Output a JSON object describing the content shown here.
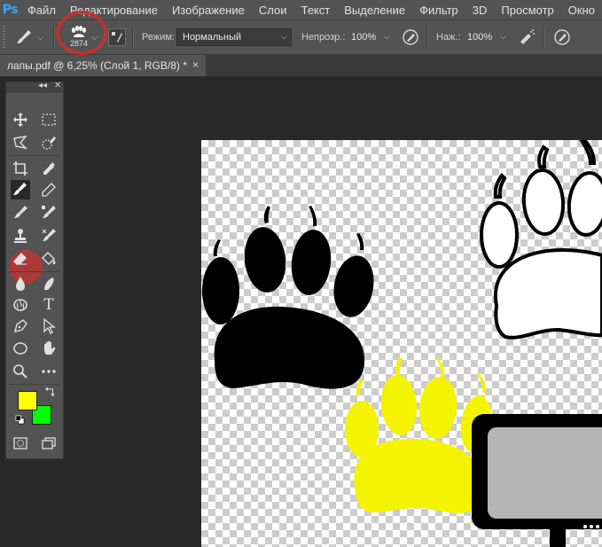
{
  "app": {
    "logo": "Ps"
  },
  "menu": {
    "items": [
      "Файл",
      "Редактирование",
      "Изображение",
      "Слои",
      "Текст",
      "Выделение",
      "Фильтр",
      "3D",
      "Просмотр",
      "Окно"
    ]
  },
  "options": {
    "brush_size": "2874",
    "mode_label": "Режим:",
    "mode_value": "Нормальный",
    "opacity_label": "Непрозр.:",
    "opacity_value": "100%",
    "flow_label": "Наж.:",
    "flow_value": "100%"
  },
  "document": {
    "tab_title": "лапы.pdf @ 6,25% (Слой 1, RGB/8) *",
    "close_icon": "×"
  },
  "toolbar": {
    "collapse": "◂◂",
    "close": "✕",
    "type_tool_glyph": "T"
  },
  "colors": {
    "foreground": "#ffff00",
    "background": "#00ff00",
    "annotation": "#c8302d",
    "paw_black": "#000000",
    "paw_yellow": "#f4f400",
    "monitor_screen": "#b5b5b5"
  }
}
